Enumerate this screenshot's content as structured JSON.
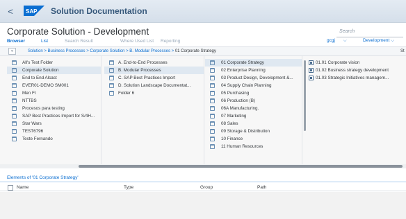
{
  "shell": {
    "back_label": "<",
    "logo_text": "SAP",
    "title": "Solution Documentation"
  },
  "header": {
    "page_title": "Corporate Solution - Development",
    "search_placeholder": "Search",
    "tabs": [
      {
        "label": "Browser",
        "state": "active"
      },
      {
        "label": "List",
        "state": "enabled"
      },
      {
        "label": "Search Result",
        "state": "disabled"
      },
      {
        "label": "Where Used List",
        "state": "disabled"
      },
      {
        "label": "Reporting",
        "state": "disabled"
      }
    ],
    "user_value": "gcgj",
    "system_value": "Development"
  },
  "breadcrumb": {
    "collapse_label": "«",
    "items": [
      "Solution",
      "Business Processes",
      "Corporate Solution",
      "B. Modular Processes"
    ],
    "separator": " > ",
    "current": "01 Corporate Strategy",
    "right_text": "St"
  },
  "columns": [
    {
      "items": [
        {
          "label": "All's Test Folder",
          "icon": "folder-icon",
          "selected": false
        },
        {
          "label": "Corporate Solution",
          "icon": "folder-icon",
          "selected": true
        },
        {
          "label": "End to End Alcast",
          "icon": "folder-icon",
          "selected": false
        },
        {
          "label": "EVER01-DEMO SM001",
          "icon": "folder-icon",
          "selected": false
        },
        {
          "label": "Men FI",
          "icon": "folder-icon",
          "selected": false
        },
        {
          "label": "NTTBS",
          "icon": "folder-icon",
          "selected": false
        },
        {
          "label": "Procesos para testing",
          "icon": "folder-icon",
          "selected": false
        },
        {
          "label": "SAP Best Practices Import for S/4H...",
          "icon": "folder-icon",
          "selected": false
        },
        {
          "label": "Star Wars",
          "icon": "folder-icon",
          "selected": false
        },
        {
          "label": "TEST6796",
          "icon": "folder-icon",
          "selected": false
        },
        {
          "label": "Teste Fernando",
          "icon": "folder-icon",
          "selected": false
        }
      ]
    },
    {
      "items": [
        {
          "label": "A. End-to-End Processes",
          "icon": "folder-icon",
          "selected": false
        },
        {
          "label": "B. Modular Processes",
          "icon": "folder-icon",
          "selected": true
        },
        {
          "label": "C. SAP Best Practices Import",
          "icon": "folder-icon",
          "selected": false
        },
        {
          "label": "D. Solution Landscape Documentat...",
          "icon": "folder-icon",
          "selected": false
        },
        {
          "label": "Folder 6",
          "icon": "folder-icon",
          "selected": false
        }
      ]
    },
    {
      "items": [
        {
          "label": "01 Corporate Strategy",
          "icon": "folder-icon",
          "selected": true
        },
        {
          "label": "02 Enterprise Planning",
          "icon": "folder-icon",
          "selected": false
        },
        {
          "label": "03 Product Design, Development &...",
          "icon": "folder-icon",
          "selected": false
        },
        {
          "label": "04 Supply Chain Planning",
          "icon": "folder-icon",
          "selected": false
        },
        {
          "label": "05 Purchasing",
          "icon": "folder-icon",
          "selected": false
        },
        {
          "label": "06 Production (B)",
          "icon": "folder-icon",
          "selected": false
        },
        {
          "label": "06A Manufacturing.",
          "icon": "folder-icon",
          "selected": false
        },
        {
          "label": "07 Marketing",
          "icon": "folder-icon",
          "selected": false
        },
        {
          "label": "08 Sales",
          "icon": "folder-icon",
          "selected": false
        },
        {
          "label": "09 Storage & Distribution",
          "icon": "folder-icon",
          "selected": false
        },
        {
          "label": "10 Finance",
          "icon": "folder-icon",
          "selected": false
        },
        {
          "label": "11 Human Resources",
          "icon": "folder-icon",
          "selected": false
        }
      ]
    },
    {
      "items": [
        {
          "label": "01.01 Corporate vision",
          "icon": "scenario-icon",
          "selected": false
        },
        {
          "label": "01.02 Business strategy development",
          "icon": "scenario-icon",
          "selected": false
        },
        {
          "label": "01.03 Strategic Initiatives managem...",
          "icon": "scenario-icon",
          "selected": false
        }
      ]
    }
  ],
  "elements": {
    "title": "Elements of '01 Corporate Strategy'",
    "columns": [
      "Name",
      "Type",
      "Group",
      "Path"
    ]
  },
  "colors": {
    "accent": "#0a6ed1",
    "shell_text": "#35577a",
    "selected_row": "#dfe8f1",
    "sap_logo": "#0a6ed1"
  }
}
